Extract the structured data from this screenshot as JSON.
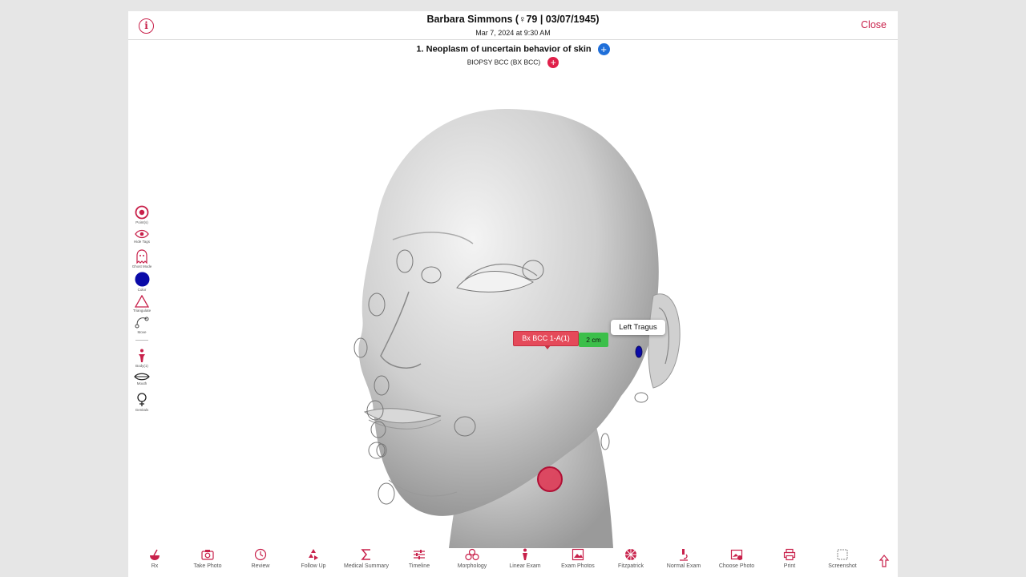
{
  "header": {
    "info_icon": "info-icon",
    "patient_name": "Barbara Simmons (♀79 | 03/07/1945)",
    "visit_date": "Mar 7, 2024 at 9:30 AM",
    "close_label": "Close"
  },
  "diagnosis": {
    "label": "1. Neoplasm of uncertain behavior of skin",
    "procedure": "BIOPSY BCC (BX BCC)"
  },
  "left_toolbar": [
    {
      "icon": "target-icon",
      "label": "Point(s)"
    },
    {
      "icon": "eye-icon",
      "label": "Hide Tags"
    },
    {
      "icon": "ghost-icon",
      "label": "Ghost Mode"
    },
    {
      "icon": "color-swatch-icon",
      "label": "Color",
      "color": "#0a0aa8"
    },
    {
      "icon": "triangle-icon",
      "label": "Triangulate"
    },
    {
      "icon": "move-icon",
      "label": "Move"
    },
    {
      "icon": "body-icon",
      "label": "Body(1)"
    },
    {
      "icon": "mouth-icon",
      "label": "Mouth"
    },
    {
      "icon": "genitals-icon",
      "label": "Genitals"
    }
  ],
  "tags": {
    "lesion_label": "Bx BCC 1-A(1)",
    "size_label": "2 cm",
    "location_label": "Left Tragus"
  },
  "bottom_bar": [
    {
      "icon": "rx-icon",
      "label": "Rx"
    },
    {
      "icon": "camera-icon",
      "label": "Take Photo"
    },
    {
      "icon": "review-icon",
      "label": "Review"
    },
    {
      "icon": "recycle-icon",
      "label": "Follow Up"
    },
    {
      "icon": "sigma-icon",
      "label": "Medical Summary"
    },
    {
      "icon": "timeline-icon",
      "label": "Timeline"
    },
    {
      "icon": "morphology-icon",
      "label": "Morphology"
    },
    {
      "icon": "linear-exam-icon",
      "label": "Linear Exam"
    },
    {
      "icon": "exam-photos-icon",
      "label": "Exam Photos"
    },
    {
      "icon": "fitzpatrick-icon",
      "label": "Fitzpatrick"
    },
    {
      "icon": "microscope-icon",
      "label": "Normal Exam"
    },
    {
      "icon": "choose-photo-icon",
      "label": "Choose Photo"
    },
    {
      "icon": "printer-icon",
      "label": "Print"
    },
    {
      "icon": "screenshot-icon",
      "label": "Screenshot"
    }
  ],
  "colors": {
    "accent": "#c8204a",
    "plus_blue": "#1f6fd9",
    "tag_red": "#e54a5a",
    "tag_green": "#3cbf4a",
    "marker_color": "#0a0aa8"
  }
}
